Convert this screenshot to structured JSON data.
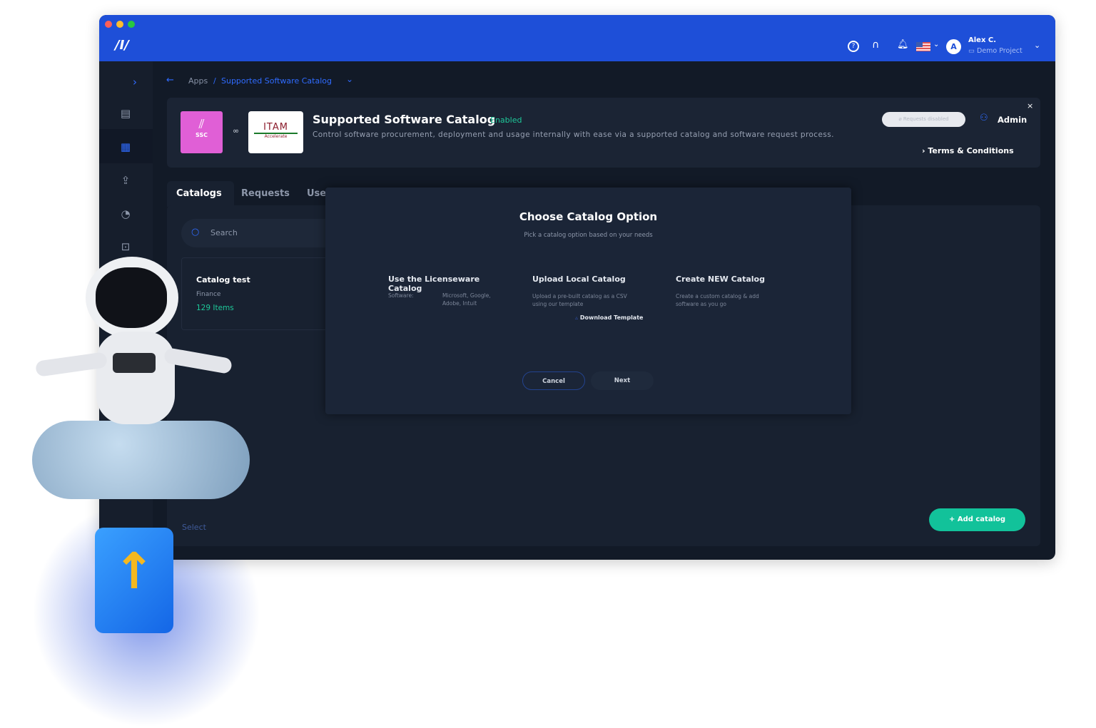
{
  "topbar": {
    "user_name": "Alex C.",
    "project": "Demo Project",
    "avatar_letter": "A"
  },
  "breadcrumb": {
    "root": "Apps",
    "separator": "/",
    "current": "Supported Software Catalog"
  },
  "app": {
    "logo_text": "SSC",
    "partner_logo_text": "ITAM",
    "partner_logo_sub": "Accelerate",
    "title": "Supported Software Catalog",
    "status": "Enabled",
    "description": "Control software procurement, deployment and usage internally with ease via a supported catalog and software request process.",
    "requests_badge": "Requests disabled",
    "role": "Admin",
    "terms": "Terms & Conditions"
  },
  "tabs": [
    "Catalogs",
    "Requests",
    "Use"
  ],
  "search": {
    "placeholder": "Search"
  },
  "catalog_item": {
    "name": "Catalog test",
    "category": "Finance",
    "count": "129 Items"
  },
  "select_text": "Select",
  "add_catalog": "+ Add catalog",
  "modal": {
    "title": "Choose Catalog Option",
    "subtitle": "Pick a catalog option based on your needs",
    "options": [
      {
        "title": "Use the Licenseware Catalog",
        "label": "Software:",
        "desc": "Microsoft, Google, Adobe, Intuit"
      },
      {
        "title": "Upload Local Catalog",
        "desc": "Upload a pre-built catalog as a CSV using our template",
        "link": "Download Template"
      },
      {
        "title": "Create NEW Catalog",
        "desc": "Create a custom catalog & add software as you go"
      }
    ],
    "cancel": "Cancel",
    "next": "Next"
  },
  "colors": {
    "topbar": "#1e4fd8",
    "accent": "#2f6bff",
    "enabled": "#1ec99a",
    "add_button": "#12c29a",
    "ssc_logo": "#e05fd6"
  }
}
